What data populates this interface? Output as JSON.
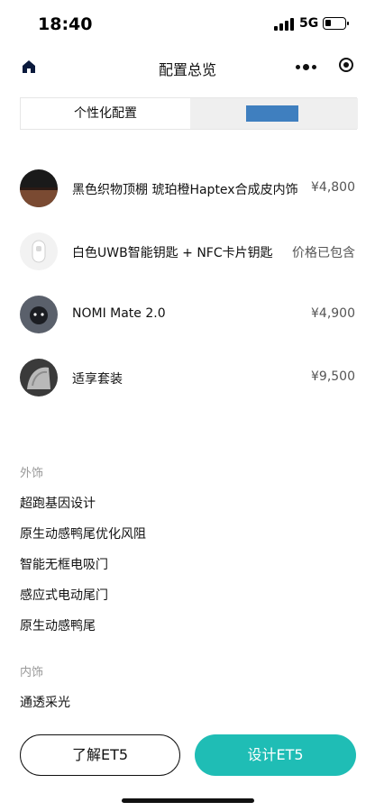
{
  "status_bar": {
    "time": "18:40",
    "network": "5G"
  },
  "nav": {
    "title": "配置总览"
  },
  "tabs": [
    {
      "label": "个性化配置"
    },
    {
      "label": ""
    }
  ],
  "options": [
    {
      "name": "黑色织物顶棚 琥珀橙Haptex合成皮内饰",
      "price": "¥4,800",
      "thumb_color": "#3a2620"
    },
    {
      "name": "白色UWB智能钥匙 + NFC卡片钥匙",
      "price": "价格已包含",
      "thumb_color": "#eeeeee"
    },
    {
      "name": "NOMI Mate 2.0",
      "price": "¥4,900",
      "thumb_color": "#4a4f58"
    },
    {
      "name": "适享套装",
      "price": "¥9,500",
      "thumb_color": "#9a9a9a"
    }
  ],
  "exterior": {
    "title": "外饰",
    "items": [
      "超跑基因设计",
      "原生动感鸭尾优化风阻",
      "智能无框电吸门",
      "感应式电动尾门",
      "原生动感鸭尾"
    ]
  },
  "interior": {
    "title": "内饰",
    "items": [
      "通透采光"
    ]
  },
  "buttons": {
    "learn": "了解ET5",
    "design": "设计ET5"
  },
  "colors": {
    "accent": "#1fbdb5",
    "tab_highlight": "#3f7fbf"
  }
}
